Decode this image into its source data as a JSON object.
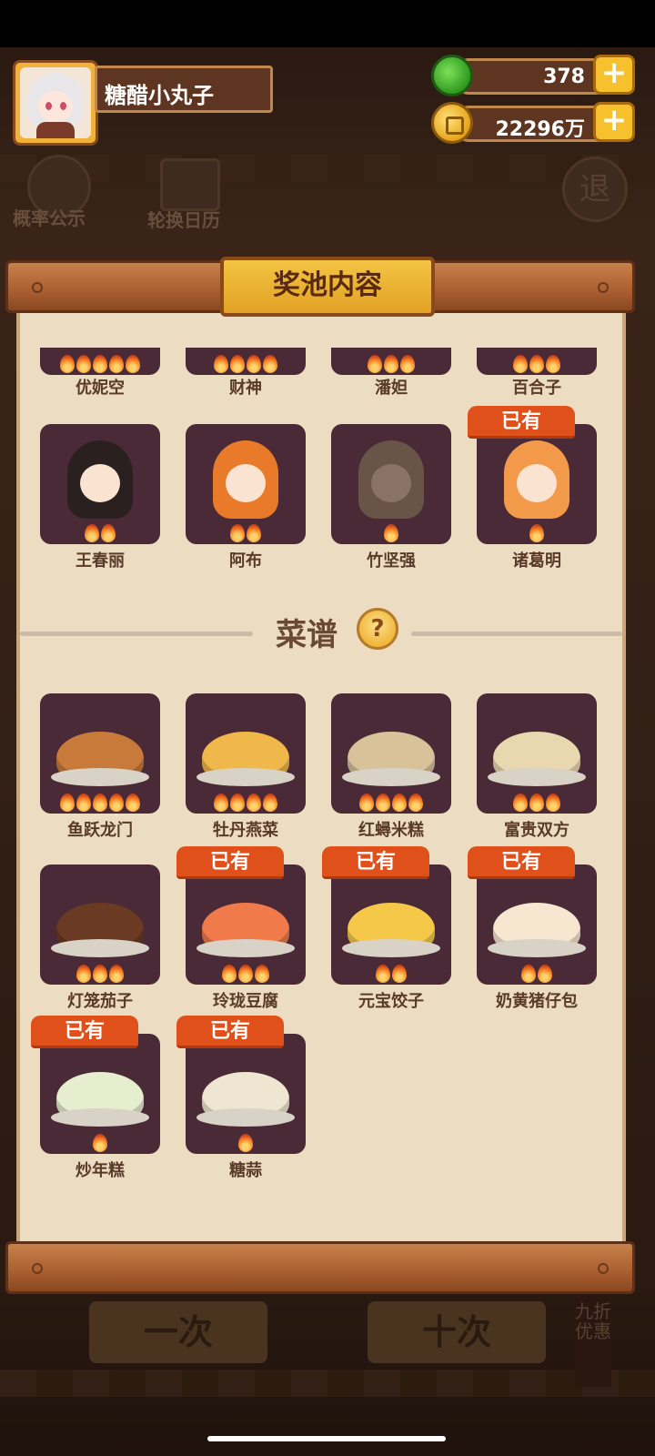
{
  "player": {
    "name": "糖醋小丸子"
  },
  "resources": {
    "gems": "378",
    "coins": "22296万"
  },
  "background": {
    "rate_label": "概率公示",
    "calendar_label": "轮换日历",
    "exit_label": "退",
    "single_draw": "一次",
    "ten_draw": "十次",
    "discount": "九折优惠"
  },
  "panel": {
    "title": "奖池内容"
  },
  "characters_partial": [
    {
      "name": "优妮空",
      "stars": 5
    },
    {
      "name": "财神",
      "stars": 4
    },
    {
      "name": "潘妲",
      "stars": 3
    },
    {
      "name": "百合子",
      "stars": 3
    }
  ],
  "characters": [
    {
      "name": "王春丽",
      "stars": 2,
      "owned": false
    },
    {
      "name": "阿布",
      "stars": 2,
      "owned": false
    },
    {
      "name": "竹坚强",
      "stars": 1,
      "owned": false
    },
    {
      "name": "诸葛明",
      "stars": 1,
      "owned": true
    }
  ],
  "recipes_section": {
    "title": "菜谱",
    "help": "?"
  },
  "owned_label": "已有",
  "recipes": [
    {
      "name": "鱼跃龙门",
      "stars": 5,
      "owned": false
    },
    {
      "name": "牡丹燕菜",
      "stars": 4,
      "owned": false
    },
    {
      "name": "红蟳米糕",
      "stars": 4,
      "owned": false
    },
    {
      "name": "富贵双方",
      "stars": 3,
      "owned": false
    },
    {
      "name": "灯笼茄子",
      "stars": 3,
      "owned": false
    },
    {
      "name": "玲珑豆腐",
      "stars": 3,
      "owned": true
    },
    {
      "name": "元宝饺子",
      "stars": 2,
      "owned": true
    },
    {
      "name": "奶黄猪仔包",
      "stars": 2,
      "owned": true
    },
    {
      "name": "炒年糕",
      "stars": 1,
      "owned": true
    },
    {
      "name": "糖蒜",
      "stars": 1,
      "owned": true
    }
  ],
  "colors": {
    "card_bg": "#4a2a36",
    "owned_tag": "#e0501a",
    "panel_bg": "#ecdcc2",
    "title_badge": "#f3c443"
  }
}
